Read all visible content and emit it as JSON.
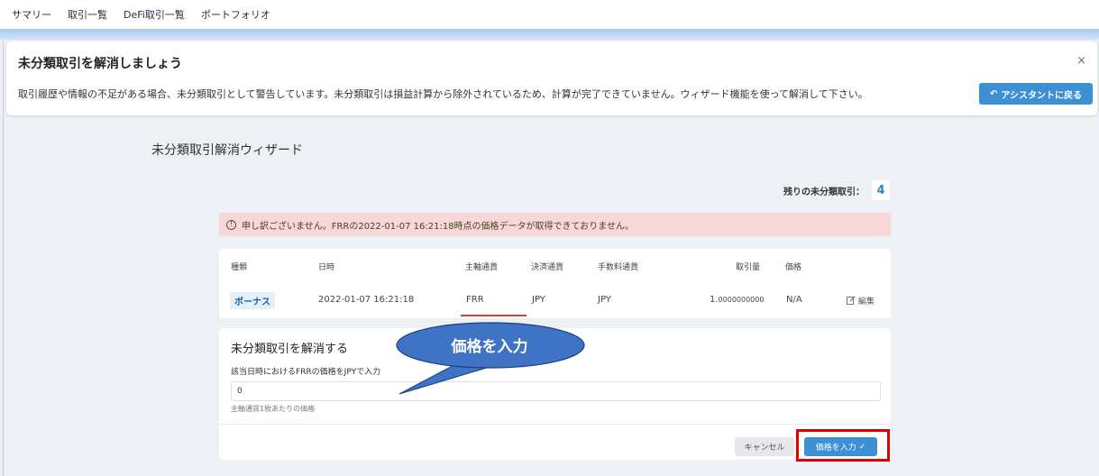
{
  "nav": {
    "items": [
      "サマリー",
      "取引一覧",
      "DeFi取引一覧",
      "ポートフォリオ"
    ]
  },
  "banner": {
    "title": "未分類取引を解消しましょう",
    "text": "取引履歴や情報の不足がある場合、未分類取引として警告しています。未分類取引は損益計算から除外されているため、計算が完了できていません。ウィザード機能を使って解消して下さい。",
    "close": "×",
    "assist_icon": "↶",
    "assist_label": "アシスタントに戻る"
  },
  "wizard": {
    "title": "未分類取引解消ウィザード",
    "remaining_label": "残りの未分類取引：",
    "remaining_count": "4"
  },
  "alert": {
    "icon": "!",
    "text": "申し訳ございません。FRRの2022-01-07 16:21:18時点の価格データが取得できておりません。"
  },
  "table": {
    "headers": [
      "種類",
      "日時",
      "主軸通貨",
      "決済通貨",
      "手数料通貨",
      "取引量",
      "価格"
    ],
    "row": {
      "type": "ボーナス",
      "datetime": "2022-01-07 16:21:18",
      "base": "FRR",
      "quote": "JPY",
      "fee": "JPY",
      "amount_int": "1.",
      "amount_dec": "0000000000",
      "price": "N/A",
      "edit": "編集"
    }
  },
  "resolve": {
    "title": "未分類取引を解消する",
    "field_label": "該当日時におけるFRRの価格をJPYで入力",
    "input_value": "0",
    "hint": "主軸通貨1枚あたりの価格",
    "cancel": "キャンセル",
    "submit": "価格を入力",
    "submit_icon": "✓"
  },
  "callout": {
    "text": "価格を入力"
  },
  "colors": {
    "primary": "#3d8fd6",
    "alert_bg": "#f8d7d9",
    "highlight": "#e00000",
    "callout": "#3f73c6"
  }
}
